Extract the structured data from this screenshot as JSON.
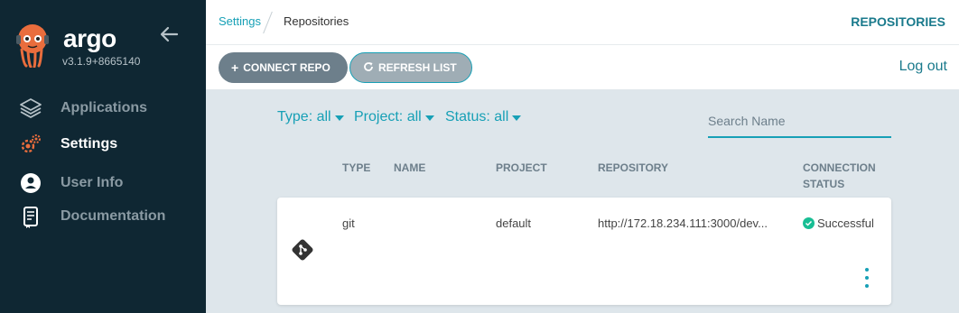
{
  "sidebar": {
    "brand": "argo",
    "version": "v3.1.9+8665140",
    "items": [
      {
        "label": "Applications",
        "icon": "layers-icon",
        "active": false
      },
      {
        "label": "Settings",
        "icon": "gears-icon",
        "active": true
      },
      {
        "label": "User Info",
        "icon": "user-circle-icon",
        "active": false
      },
      {
        "label": "Documentation",
        "icon": "book-icon",
        "active": false
      }
    ]
  },
  "topbar": {
    "breadcrumb": [
      "Settings",
      "Repositories"
    ],
    "title": "REPOSITORIES"
  },
  "toolbar": {
    "connect_label": "CONNECT REPO",
    "refresh_label": "REFRESH LIST",
    "logout_label": "Log out"
  },
  "filters": {
    "type": "Type: all",
    "project": "Project: all",
    "status": "Status: all",
    "search_placeholder": "Search Name"
  },
  "table": {
    "headers": [
      "TYPE",
      "NAME",
      "PROJECT",
      "REPOSITORY",
      "CONNECTION",
      "STATUS"
    ],
    "rows": [
      {
        "type": "git",
        "name": "",
        "project": "default",
        "repository": "http://172.18.234.111:3000/dev...",
        "status": "Successful"
      }
    ]
  },
  "colors": {
    "sidebar_bg": "#0f2733",
    "accent": "#17a0b6",
    "success": "#18be94",
    "settings_icon": "#e96d3d"
  }
}
